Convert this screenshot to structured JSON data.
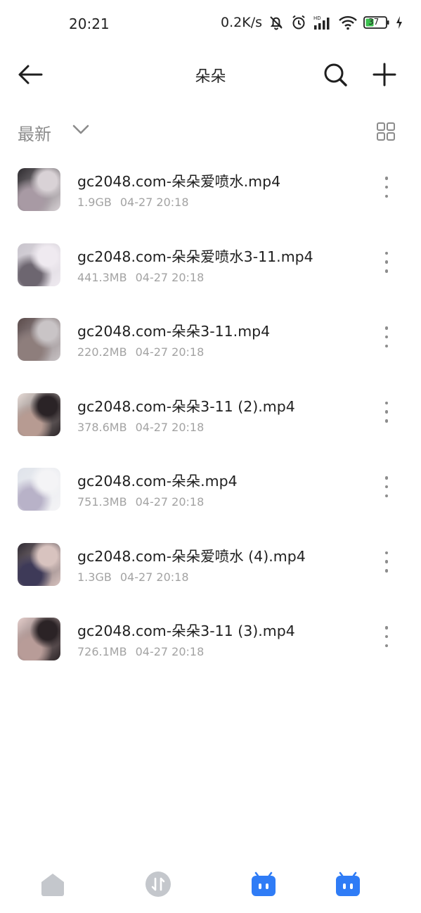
{
  "status_bar": {
    "time": "20:21",
    "net_speed": "0.2K/s",
    "battery": "37",
    "icons": [
      "mute-bell-icon",
      "alarm-icon",
      "hd-signal-icon",
      "wifi-icon",
      "battery-icon",
      "charging-icon"
    ]
  },
  "header": {
    "title": "朵朵",
    "back_icon": "back-arrow-icon",
    "search_icon": "search-icon",
    "add_icon": "plus-icon"
  },
  "sort": {
    "label": "最新",
    "chevron_icon": "chevron-down-icon",
    "view_icon": "grid-view-icon"
  },
  "files": [
    {
      "name": "gc2048.com-朵朵爱喷水.mp4",
      "size": "1.9GB",
      "date": "04-27 20:18",
      "thumb_colors": [
        "#2d2a2e",
        "#d9d2d6",
        "#a89aa4"
      ]
    },
    {
      "name": "gc2048.com-朵朵爱喷水3-11.mp4",
      "size": "441.3MB",
      "date": "04-27 20:18",
      "thumb_colors": [
        "#c8c4cc",
        "#efeaf0",
        "#6d6670"
      ]
    },
    {
      "name": "gc2048.com-朵朵3-11.mp4",
      "size": "220.2MB",
      "date": "04-27 20:18",
      "thumb_colors": [
        "#5a4a4a",
        "#c9c4c6",
        "#8e7e7c"
      ]
    },
    {
      "name": "gc2048.com-朵朵3-11 (2).mp4",
      "size": "378.6MB",
      "date": "04-27 20:18",
      "thumb_colors": [
        "#e8ddd8",
        "#2a2326",
        "#b79b92"
      ]
    },
    {
      "name": "gc2048.com-朵朵.mp4",
      "size": "751.3MB",
      "date": "04-27 20:18",
      "thumb_colors": [
        "#dfe3ea",
        "#f4f4f6",
        "#b8b2c8"
      ]
    },
    {
      "name": "gc2048.com-朵朵爱喷水 (4).mp4",
      "size": "1.3GB",
      "date": "04-27 20:18",
      "thumb_colors": [
        "#2f2a33",
        "#d8c3bf",
        "#3e3a58"
      ]
    },
    {
      "name": "gc2048.com-朵朵3-11 (3).mp4",
      "size": "726.1MB",
      "date": "04-27 20:18",
      "thumb_colors": [
        "#e6cfcc",
        "#2b2326",
        "#b89c98"
      ]
    }
  ],
  "bottom_nav": [
    {
      "name": "home-icon",
      "color": "#c4c7cc"
    },
    {
      "name": "transfer-icon",
      "color": "#c4c7cc"
    },
    {
      "name": "robot-box-icon",
      "color": "#2f7cf6"
    },
    {
      "name": "robot-box-icon",
      "color": "#2f7cf6"
    }
  ],
  "colors": {
    "text": "#1f1f1f",
    "muted": "#a3a3a3",
    "accent": "#2f7cf6"
  }
}
